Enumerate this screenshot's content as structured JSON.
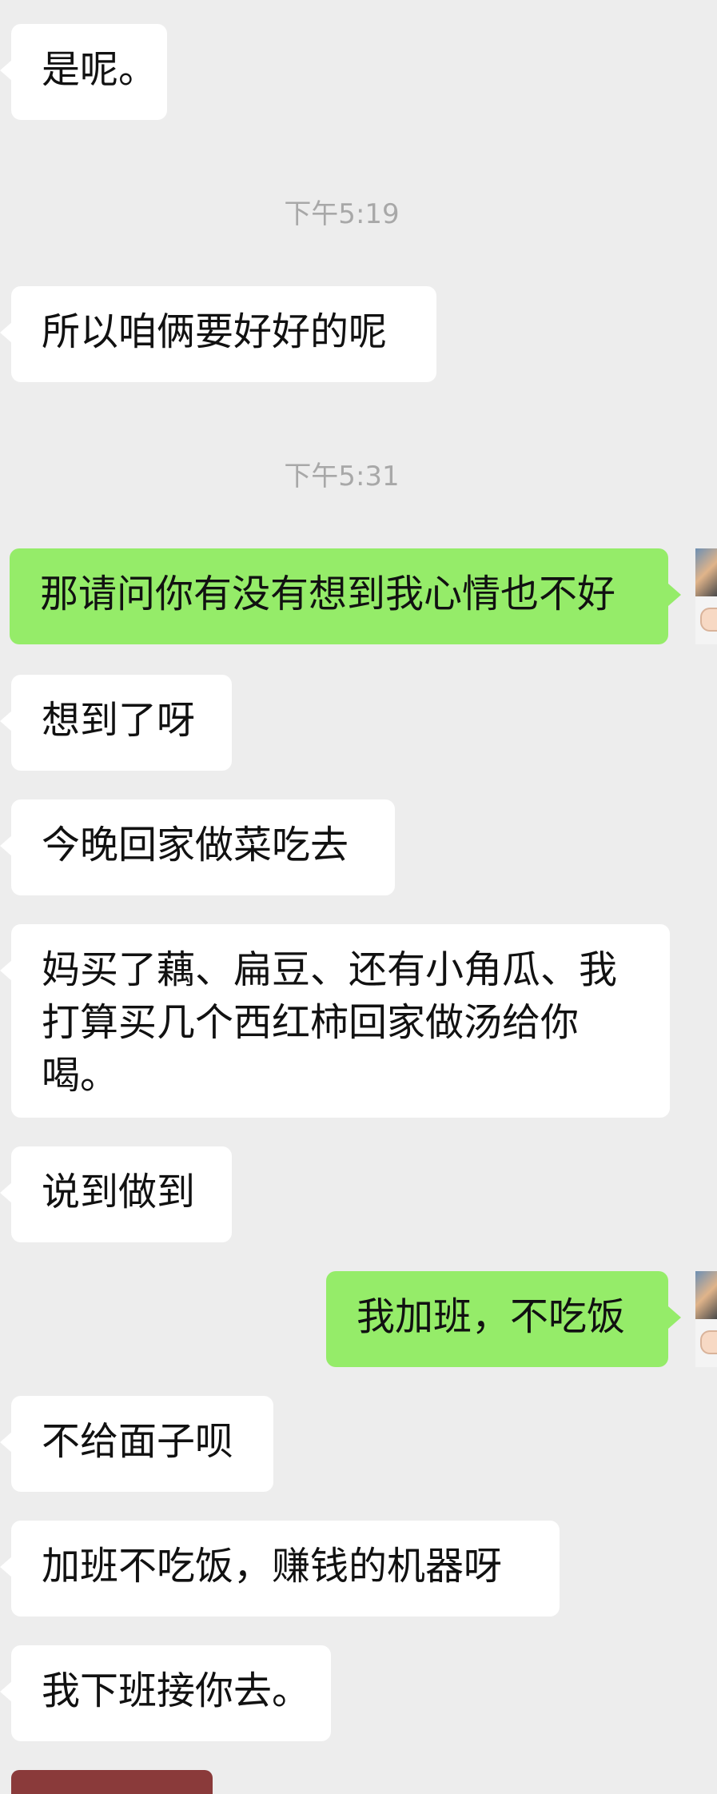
{
  "messages": [
    {
      "id": "m1",
      "text": "是呢。"
    },
    {
      "id": "t1",
      "text": "下午5:19"
    },
    {
      "id": "m2",
      "text": "所以咱俩要好好的呢"
    },
    {
      "id": "t2",
      "text": "下午5:31"
    },
    {
      "id": "m3",
      "text": "那请问你有没有想到我心情也不好"
    },
    {
      "id": "m4",
      "text": "想到了呀"
    },
    {
      "id": "m5",
      "text": "今晚回家做菜吃去"
    },
    {
      "id": "m6",
      "text": "妈买了藕、扁豆、还有小角瓜、我打算买几个西红柿回家做汤给你喝。"
    },
    {
      "id": "m7",
      "text": "说到做到"
    },
    {
      "id": "m8",
      "text": "我加班，不吃饭"
    },
    {
      "id": "m9",
      "text": "不给面子呗"
    },
    {
      "id": "m10",
      "text": "加班不吃饭，赚钱的机器呀"
    },
    {
      "id": "m11",
      "text": "我下班接你去。"
    }
  ],
  "theme": {
    "background": "#ededed",
    "incoming_bubble": "#ffffff",
    "outgoing_bubble": "#95ec69",
    "timestamp_color": "#a8a8a8"
  }
}
